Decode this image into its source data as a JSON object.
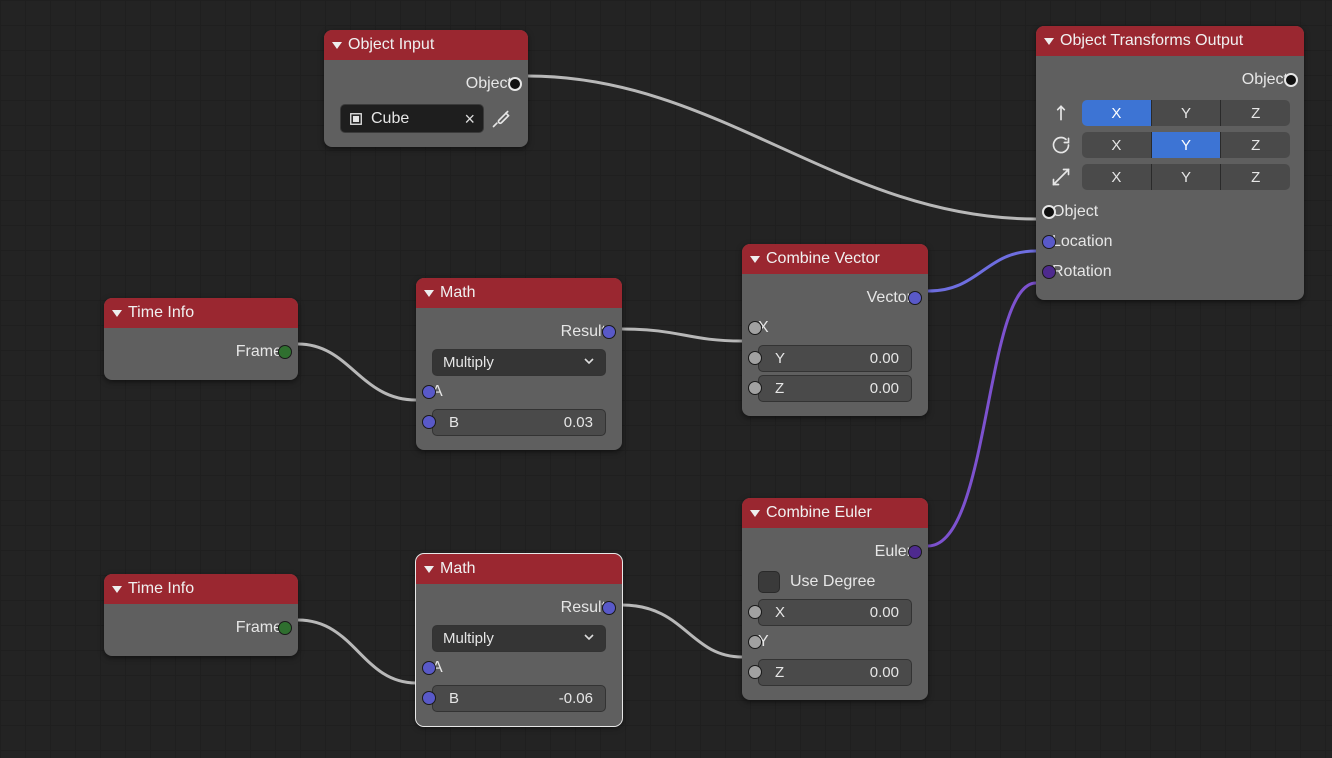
{
  "nodes": {
    "objectInput": {
      "title": "Object Input",
      "out_object_label": "Object",
      "object_value": "Cube"
    },
    "timeInfo1": {
      "title": "Time Info",
      "out_frame_label": "Frame"
    },
    "timeInfo2": {
      "title": "Time Info",
      "out_frame_label": "Frame"
    },
    "math1": {
      "title": "Math",
      "out_result_label": "Result",
      "operation": "Multiply",
      "in_a_label": "A",
      "in_b_label": "B",
      "b_value": "0.03"
    },
    "math2": {
      "title": "Math",
      "out_result_label": "Result",
      "operation": "Multiply",
      "in_a_label": "A",
      "in_b_label": "B",
      "b_value": "-0.06"
    },
    "combineVector": {
      "title": "Combine Vector",
      "out_vector_label": "Vector",
      "in_x_label": "X",
      "in_y_label": "Y",
      "y_value": "0.00",
      "in_z_label": "Z",
      "z_value": "0.00"
    },
    "combineEuler": {
      "title": "Combine Euler",
      "out_euler_label": "Euler",
      "use_degree_label": "Use Degree",
      "in_x_label": "X",
      "x_value": "0.00",
      "in_y_label": "Y",
      "in_z_label": "Z",
      "z_value": "0.00"
    },
    "transformsOut": {
      "title": "Object Transforms Output",
      "out_object_label": "Object",
      "loc": {
        "x": true,
        "y": false,
        "z": false
      },
      "rot": {
        "x": false,
        "y": true,
        "z": false
      },
      "scl": {
        "x": false,
        "y": false,
        "z": false
      },
      "in_object_label": "Object",
      "in_location_label": "Location",
      "in_rotation_label": "Rotation",
      "axis_labels": {
        "x": "X",
        "y": "Y",
        "z": "Z"
      }
    }
  }
}
